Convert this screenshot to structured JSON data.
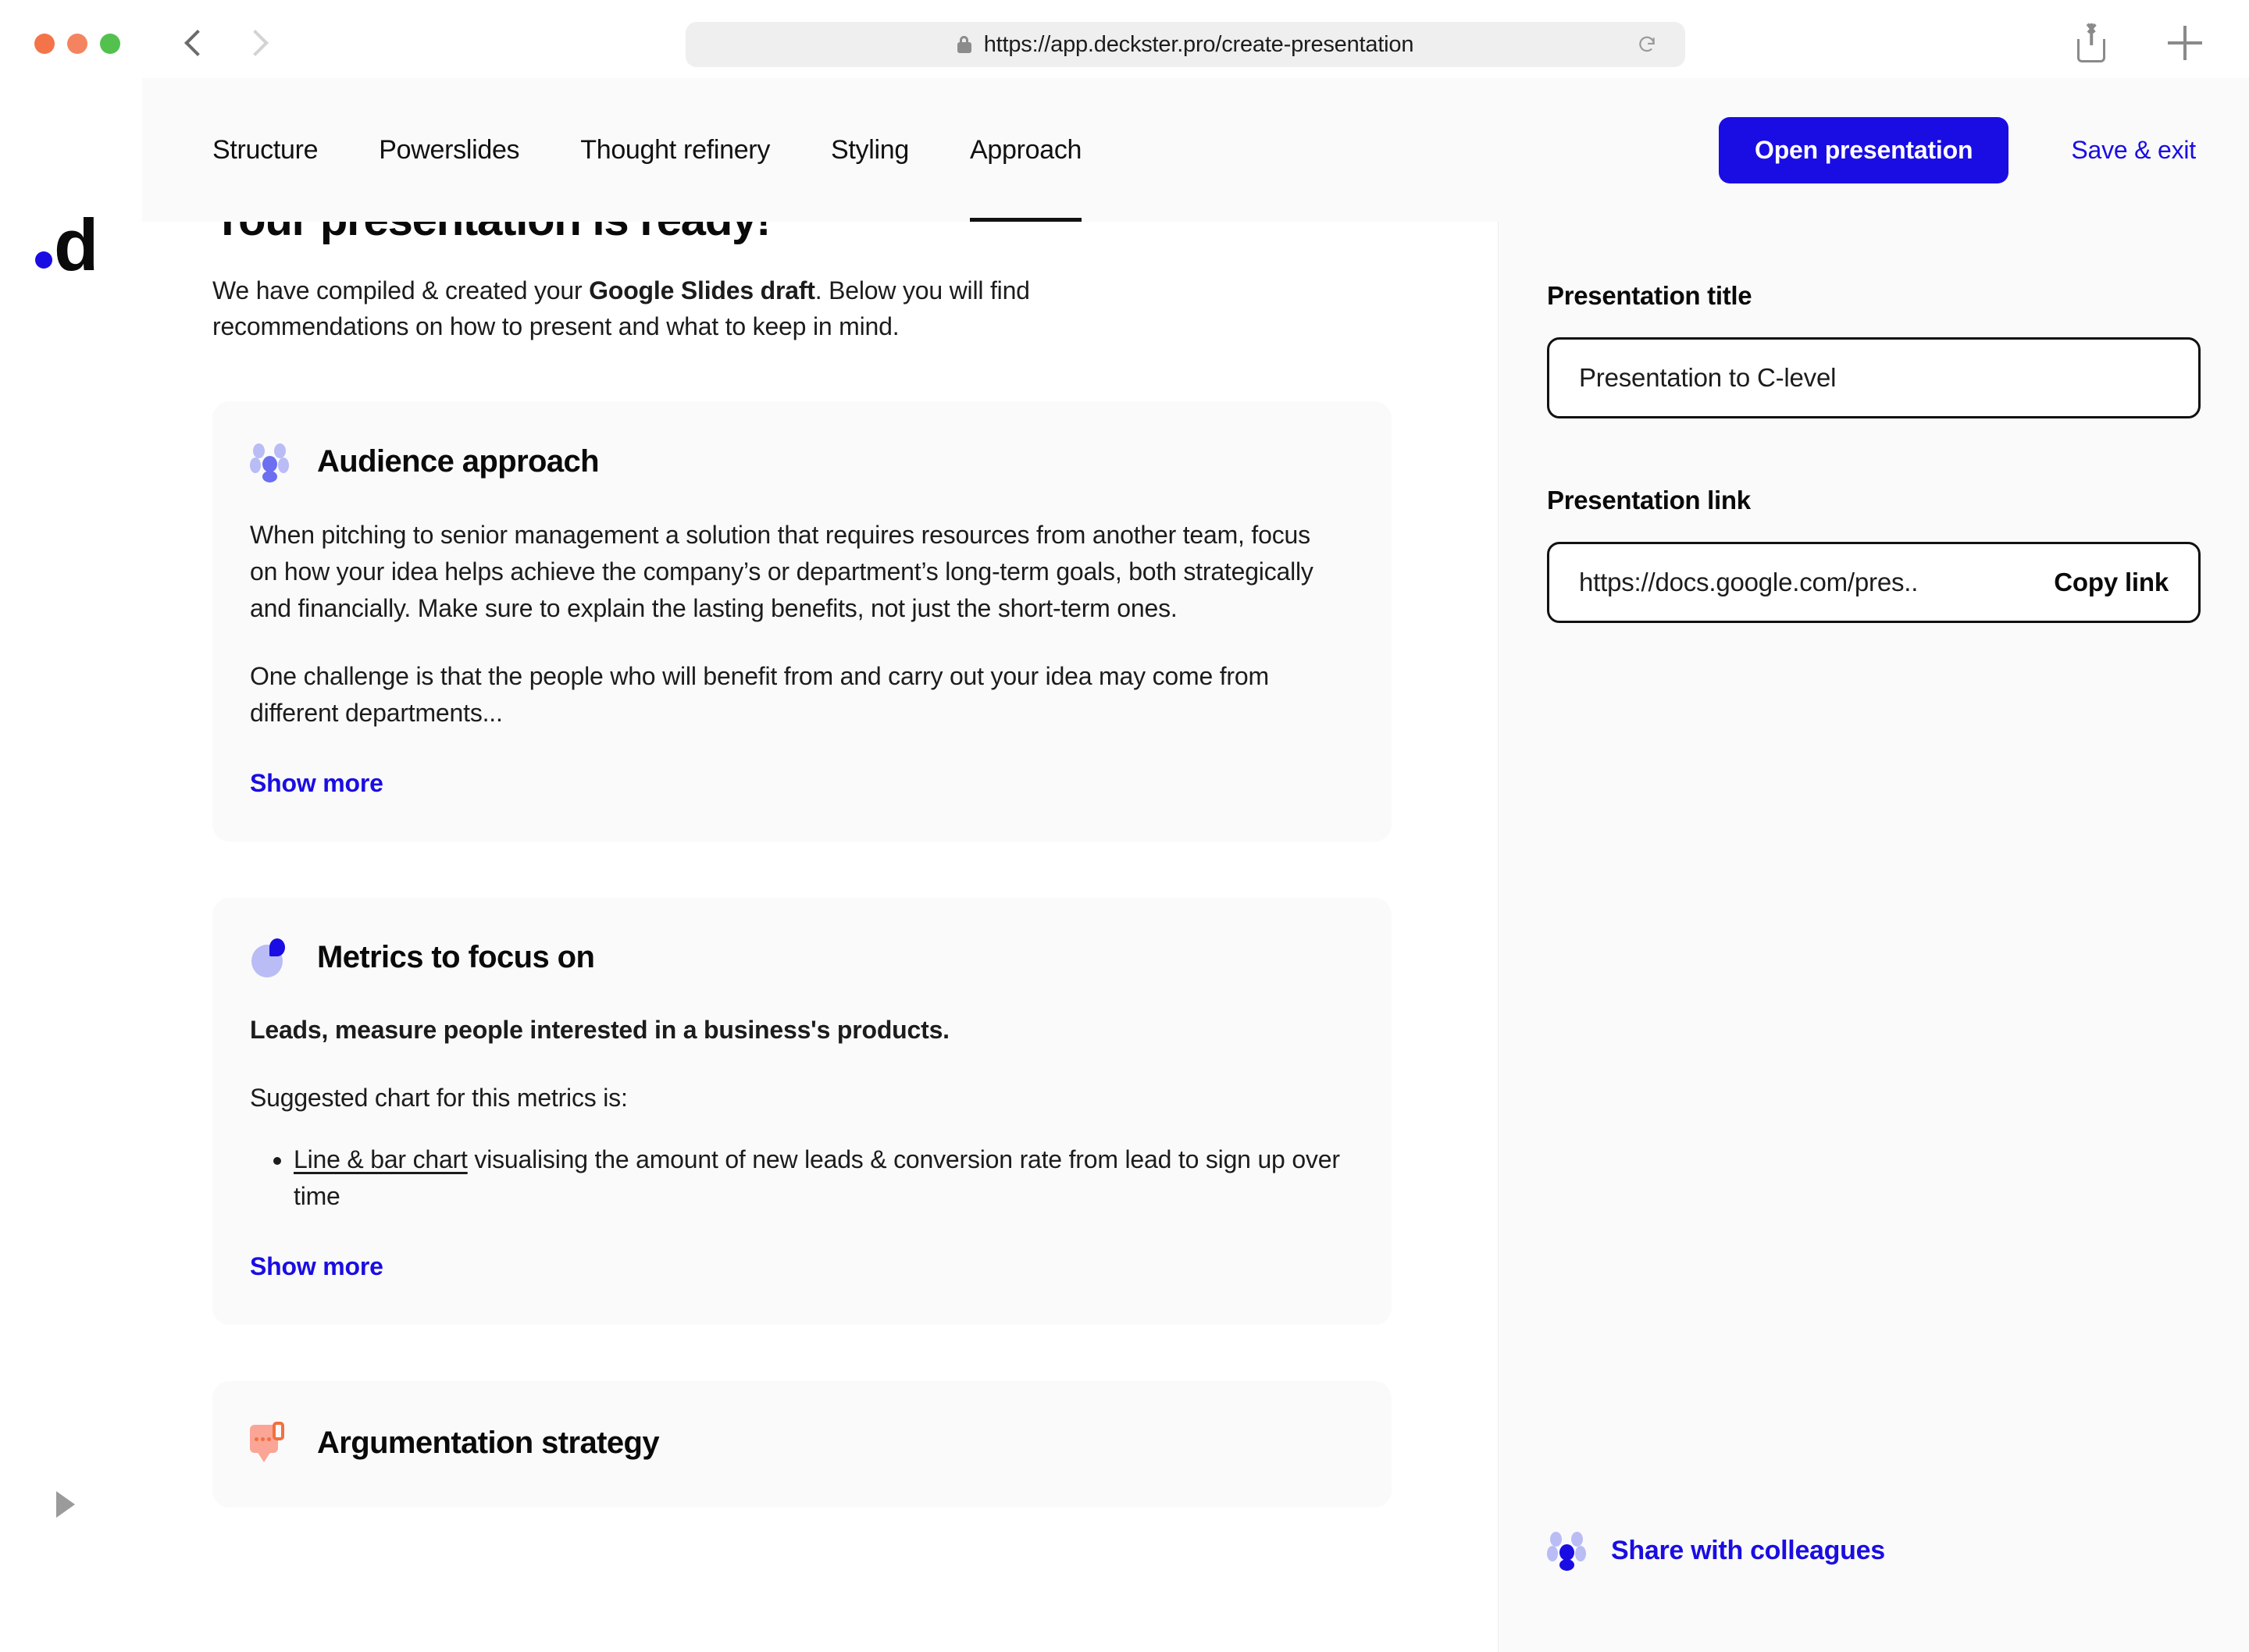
{
  "browser": {
    "url": "https://app.deckster.pro/create-presentation",
    "lock_icon": "lock-icon",
    "reload_icon": "reload-icon",
    "back_icon": "chevron-left-icon",
    "forward_icon": "chevron-right-icon",
    "share_icon": "share-icon",
    "new_tab_icon": "plus-icon"
  },
  "logo": {
    "text": "d",
    "dot_color": "#1a0de3"
  },
  "header": {
    "tabs": [
      {
        "label": "Structure",
        "active": false
      },
      {
        "label": "Powerslides",
        "active": false
      },
      {
        "label": "Thought refinery",
        "active": false
      },
      {
        "label": "Styling",
        "active": false
      },
      {
        "label": "Approach",
        "active": true
      }
    ],
    "open_presentation_label": "Open presentation",
    "save_exit_label": "Save & exit",
    "primary_color": "#1a0de3"
  },
  "main": {
    "title": "Your presentation is ready!",
    "subtitle_part1": "We have compiled & created your ",
    "subtitle_bold": "Google Slides draft",
    "subtitle_part2": ". Below you will find recommendations on how to present and what to keep in mind.",
    "cards": [
      {
        "icon": "people-group-icon",
        "title": "Audience approach",
        "paragraph1": "When pitching to senior management a solution that requires resources from another team, focus on how your idea helps achieve the company’s or department’s long-term goals, both strategically and financially. Make sure to explain the lasting benefits, not just the short-term ones.",
        "paragraph2": "One challenge is that the people who will benefit from and carry out your idea may come from different departments...",
        "show_more_label": "Show more"
      },
      {
        "icon": "pie-chart-icon",
        "title": "Metrics to focus on",
        "lead": "Leads, measure people interested in a business's products.",
        "paragraph1": "Suggested chart for this metrics is:",
        "bullet_link": "Line & bar chart",
        "bullet_rest": " visualising the amount of new leads & conversion rate from lead to sign up over time",
        "show_more_label": "Show more"
      },
      {
        "icon": "speech-bubble-icon",
        "title": "Argumentation strategy"
      }
    ]
  },
  "sidebar": {
    "title_label": "Presentation title",
    "title_value": "Presentation to C-level",
    "link_label": "Presentation link",
    "link_value": "https://docs.google.com/pres..",
    "copy_link_label": "Copy link",
    "share_label": "Share with colleagues",
    "share_icon": "people-group-icon"
  },
  "footer": {
    "expand_icon": "expand-arrow-icon"
  }
}
